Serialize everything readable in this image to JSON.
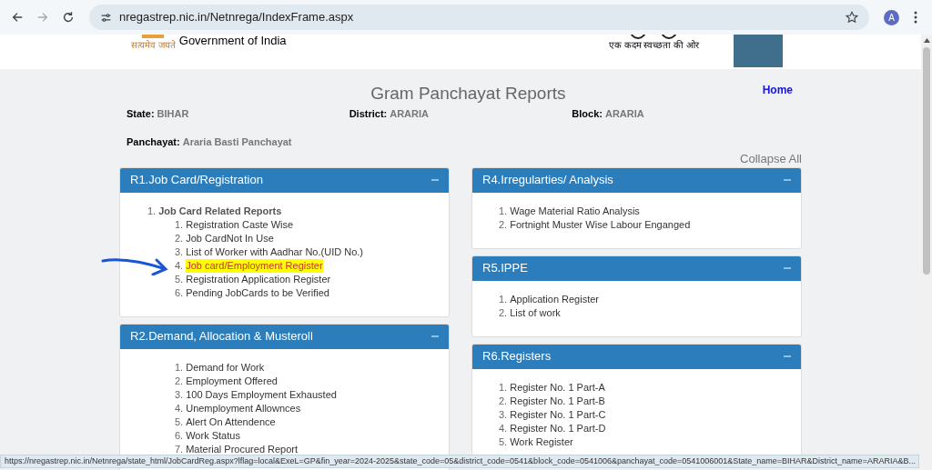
{
  "browser": {
    "url": "nregastrep.nic.in/Netnrega/IndexFrame.aspx",
    "profile_initial": "A"
  },
  "header": {
    "emblem_motto": "सत्यमेव जयते",
    "org": "Government of India",
    "slogan": "एक कदम स्वच्छता की ओर"
  },
  "title": "Gram Panchayat Reports",
  "home_link": "Home",
  "info": [
    {
      "label": "State:",
      "value": "BIHAR"
    },
    {
      "label": "District:",
      "value": "ARARIA"
    },
    {
      "label": "Block:",
      "value": "ARARIA"
    },
    {
      "label": "Panchayat:",
      "value": "Araria Basti Panchayat"
    }
  ],
  "collapse_all": "Collapse All",
  "columns": [
    [
      {
        "title": "R1.Job Card/Registration",
        "expanded": true,
        "items": [
          {
            "number": "1.",
            "text": "Job Card Related Reports",
            "highlighted": false,
            "children": [
              {
                "number": "1.",
                "text": "Registration Caste Wise",
                "highlighted": false
              },
              {
                "number": "2.",
                "text": "Job CardNot In Use",
                "highlighted": false
              },
              {
                "number": "3.",
                "text": "List of Worker with Aadhar No.(UID No.)",
                "highlighted": false
              },
              {
                "number": "4.",
                "text": "Job card/Employment Register",
                "highlighted": true
              },
              {
                "number": "5.",
                "text": "Registration Application Register",
                "highlighted": false
              },
              {
                "number": "6.",
                "text": "Pending JobCards to be Verified",
                "highlighted": false
              }
            ]
          }
        ]
      },
      {
        "title": "R2.Demand, Allocation & Musteroll",
        "expanded": true,
        "items": [
          {
            "children": [
              {
                "number": "1.",
                "text": "Demand for Work",
                "highlighted": false
              },
              {
                "number": "2.",
                "text": "Employment Offered",
                "highlighted": false
              },
              {
                "number": "3.",
                "text": "100 Days Employment Exhausted",
                "highlighted": false
              },
              {
                "number": "4.",
                "text": "Unemployment Allownces",
                "highlighted": false
              },
              {
                "number": "5.",
                "text": "Alert On Attendence",
                "highlighted": false
              },
              {
                "number": "6.",
                "text": "Work Status",
                "highlighted": false
              },
              {
                "number": "7.",
                "text": "Material Procured Report",
                "highlighted": false
              }
            ]
          }
        ]
      }
    ],
    [
      {
        "title": "R4.Irregularties/ Analysis",
        "expanded": true,
        "items": [
          {
            "number": "1.",
            "text": "Wage Material Ratio Analysis",
            "highlighted": false
          },
          {
            "number": "2.",
            "text": "Fortnight Muster Wise Labour Enganged",
            "highlighted": false
          }
        ]
      },
      {
        "title": "R5.IPPE",
        "expanded": true,
        "items": [
          {
            "number": "1.",
            "text": "Application Register",
            "highlighted": false
          },
          {
            "number": "2.",
            "text": "List of work",
            "highlighted": false
          }
        ]
      },
      {
        "title": "R6.Registers",
        "expanded": true,
        "items": [
          {
            "number": "1.",
            "text": "Register No. 1 Part-A",
            "highlighted": false
          },
          {
            "number": "2.",
            "text": "Register No. 1 Part-B",
            "highlighted": false
          },
          {
            "number": "3.",
            "text": "Register No. 1 Part-C",
            "highlighted": false
          },
          {
            "number": "4.",
            "text": "Register No. 1 Part-D",
            "highlighted": false
          },
          {
            "number": "5.",
            "text": "Work Register",
            "highlighted": false
          }
        ]
      }
    ]
  ],
  "status_bar": "https://nregastrep.nic.in/Netnrega/state_html/JobCardReg.aspx?lflag=local&ExeL=GP&fin_year=2024-2025&state_code=05&district_code=0541&block_code=0541006&panchayat_code=0541006001&State_name=BIHAR&District_name=ARARIA&B..."
}
